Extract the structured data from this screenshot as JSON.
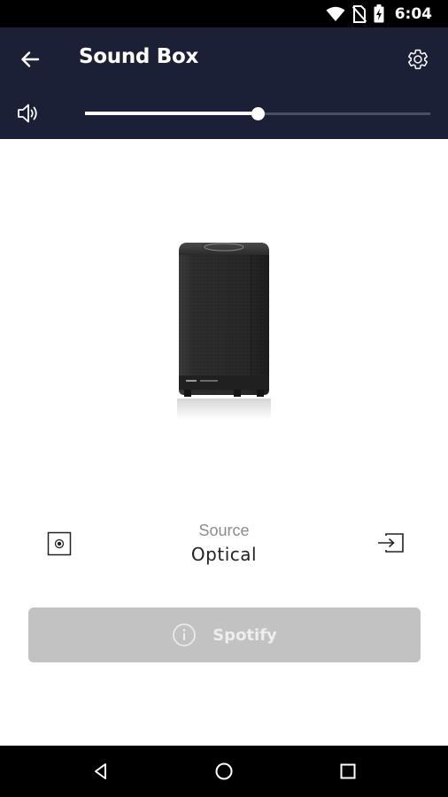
{
  "status_bar": {
    "time": "6:04",
    "icons": [
      "wifi-icon",
      "no-sim-icon",
      "battery-charging-icon"
    ]
  },
  "app_bar": {
    "title": "Sound Box",
    "back_icon": "arrow-back-icon",
    "settings_icon": "gear-icon",
    "volume_icon": "speaker-volume-icon",
    "volume_level": 0.5
  },
  "device": {
    "image": "speaker-product-image"
  },
  "source": {
    "label": "Source",
    "value": "Optical",
    "prev_icon": "optical-input-icon",
    "switch_icon": "input-switch-icon"
  },
  "spotify_button": {
    "label": "Spotify",
    "icon": "info-icon"
  },
  "nav_bar": {
    "icons": [
      "back-triangle-icon",
      "home-circle-icon",
      "recents-square-icon"
    ]
  },
  "colors": {
    "app_bar": "#1c2036",
    "button_disabled": "#c2c2c2",
    "source_label": "#8c8c8c"
  }
}
